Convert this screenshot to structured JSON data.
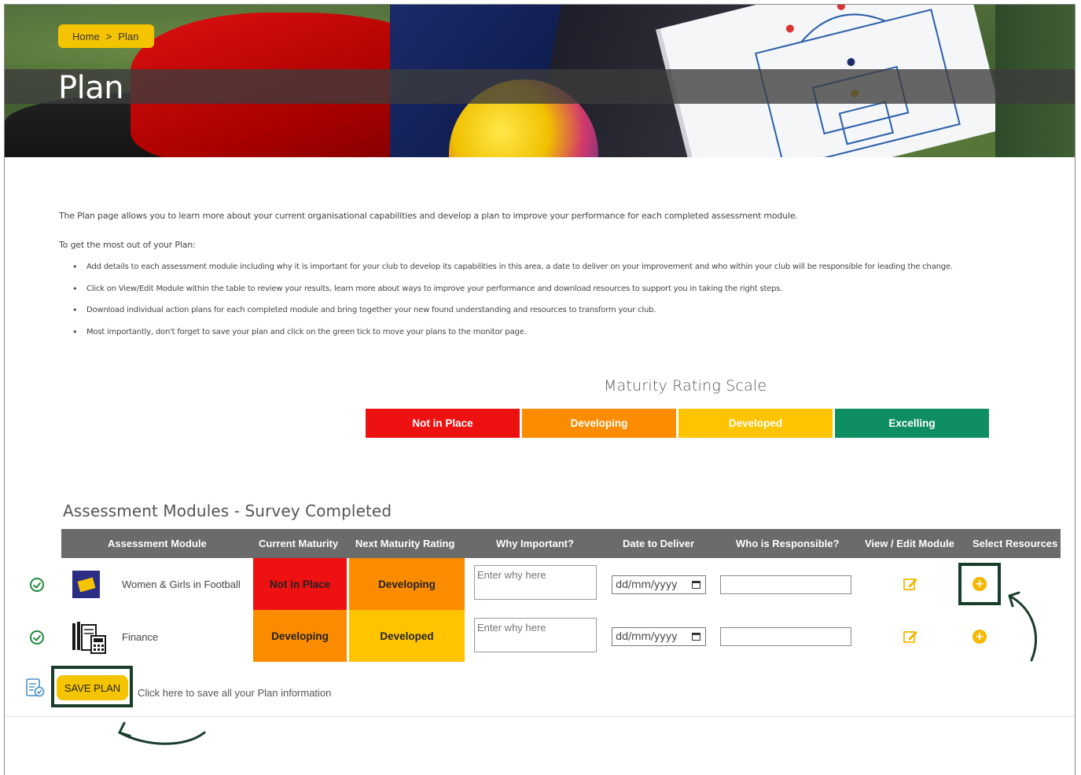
{
  "breadcrumb": {
    "home": "Home",
    "separator": ">",
    "current": "Plan"
  },
  "page_title": "Plan",
  "intro": {
    "paragraph": "The Plan page allows you to learn more about your current organisational capabilities and develop a plan to improve your performance for each completed assessment module.",
    "lead": "To get the most out of your Plan:",
    "bullets": [
      "Add details to each assessment module including why it is important for your club to develop its capabilities in this area, a date to deliver on your improvement and who within your club will be responsible for leading the change.",
      "Click on View/Edit Module within the table to review your results, learn more about ways to improve your performance and download resources to support you in taking the right steps.",
      "Download individual action plans for each completed module and bring together your new found understanding and resources to transform your club.",
      "Most importantly, don't forget to save your plan and click on the green tick to move your plans to the monitor page."
    ]
  },
  "maturity_scale": {
    "title": "Maturity Rating Scale",
    "levels": [
      {
        "label": "Not in Place",
        "color": "#ee1111"
      },
      {
        "label": "Developing",
        "color": "#fb8c00"
      },
      {
        "label": "Developed",
        "color": "#ffc400"
      },
      {
        "label": "Excelling",
        "color": "#0f8e61"
      }
    ]
  },
  "modules": {
    "title": "Assessment Modules - Survey Completed",
    "columns": [
      "Assessment Module",
      "Current Maturity",
      "Next Maturity Rating",
      "Why Important?",
      "Date to Deliver",
      "Who is Responsible?",
      "View / Edit Module",
      "Select Resources"
    ],
    "rows": [
      {
        "name": "Women & Girls in Football",
        "logo": "our-game-logo",
        "current": "Not in Place",
        "current_color": "#ee1111",
        "next": "Developing",
        "next_color": "#fb8c00",
        "why_placeholder": "Enter why here",
        "date_placeholder": "dd/mm/yyyy",
        "who": ""
      },
      {
        "name": "Finance",
        "logo": "finance-icon",
        "current": "Developing",
        "current_color": "#fb8c00",
        "next": "Developed",
        "next_color": "#ffc400",
        "why_placeholder": "Enter why here",
        "date_placeholder": "dd/mm/yyyy",
        "who": ""
      }
    ]
  },
  "save": {
    "button_label": "SAVE PLAN",
    "hint": "Click here to save all your Plan information"
  },
  "icons": {
    "check": "check-circle-icon",
    "edit": "edit-icon",
    "add": "plus-circle-icon",
    "document": "document-check-icon",
    "calendar": "calendar-icon"
  },
  "colors": {
    "accent_yellow": "#f5c400",
    "header_gray": "#6b6b6b",
    "highlight_green": "#183d2a",
    "check_green": "#1d8a3a"
  }
}
